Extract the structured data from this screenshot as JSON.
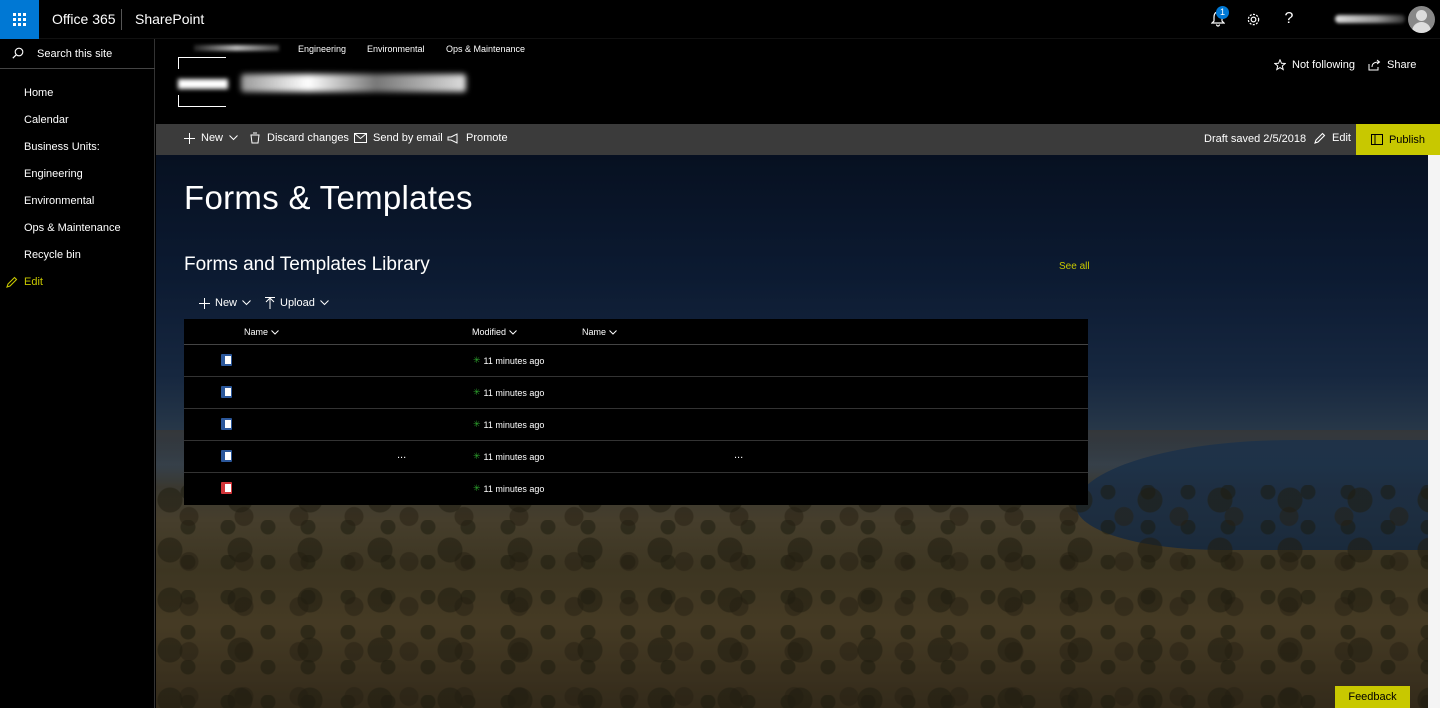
{
  "suite": {
    "app_name": "Office 365",
    "product": "SharePoint",
    "notification_count": "1",
    "help_glyph": "?"
  },
  "leftnav": {
    "search_placeholder": "Search this site",
    "items": [
      {
        "label": "Home"
      },
      {
        "label": "Calendar"
      },
      {
        "label": "Business Units:"
      },
      {
        "label": "Engineering"
      },
      {
        "label": "Environmental"
      },
      {
        "label": "Ops & Maintenance"
      },
      {
        "label": "Recycle bin"
      }
    ],
    "edit_label": "Edit"
  },
  "header": {
    "topnav": [
      "Engineering",
      "Environmental",
      "Ops & Maintenance"
    ],
    "follow_label": "Not following",
    "share_label": "Share"
  },
  "commandbar": {
    "new_label": "New",
    "discard_label": "Discard changes",
    "email_label": "Send by email",
    "promote_label": "Promote",
    "draft_status": "Draft saved 2/5/2018",
    "edit_label": "Edit",
    "publish_label": "Publish"
  },
  "page": {
    "title": "Forms & Templates",
    "library_title": "Forms and Templates Library",
    "see_all": "See all",
    "lib_new_label": "New",
    "lib_upload_label": "Upload",
    "columns": [
      "Name",
      "Modified",
      "Name"
    ],
    "rows": [
      {
        "type": "word",
        "modified": "11 minutes ago",
        "ellipsis": ""
      },
      {
        "type": "word",
        "modified": "11 minutes ago",
        "ellipsis": ""
      },
      {
        "type": "word",
        "modified": "11 minutes ago",
        "ellipsis": ""
      },
      {
        "type": "word",
        "modified": "11 minutes ago",
        "ellipsis": "..."
      },
      {
        "type": "pdf",
        "modified": "11 minutes ago",
        "ellipsis": ""
      }
    ]
  },
  "feedback_label": "Feedback",
  "colors": {
    "accent": "#c8c800",
    "waffle": "#0078d4",
    "commandbar": "#3b3b3b"
  }
}
